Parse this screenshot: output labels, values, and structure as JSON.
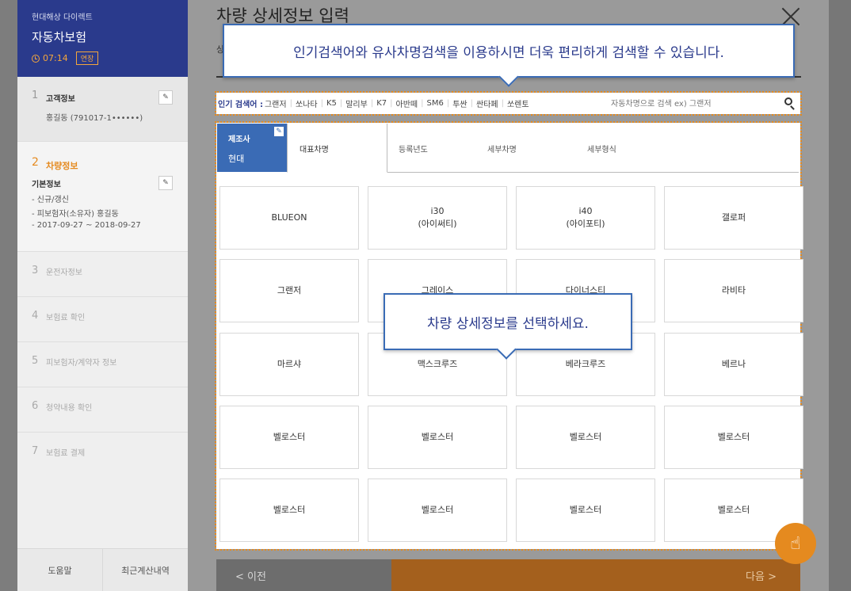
{
  "sidebar": {
    "brand": "현대해상 다이렉트",
    "product": "자동차보험",
    "timer": "07:14",
    "extend_label": "연장",
    "steps": [
      {
        "num": "1",
        "name": "고객정보",
        "detail": "홍길동 (791017-1••••••)"
      },
      {
        "num": "2",
        "name": "차량정보",
        "sub_title": "기본정보",
        "lines": [
          "- 신규/갱신",
          "- 피보험자(소유자) 홍길동",
          "- 2017-09-27 ~ 2018-09-27"
        ]
      },
      {
        "num": "3",
        "name": "운전자정보"
      },
      {
        "num": "4",
        "name": "보험료 확인"
      },
      {
        "num": "5",
        "name": "피보험자/계약자 정보"
      },
      {
        "num": "6",
        "name": "청약내용 확인"
      },
      {
        "num": "7",
        "name": "보험료 결제"
      }
    ],
    "footer": {
      "help": "도움말",
      "recent": "최근계산내역"
    }
  },
  "main": {
    "title": "차량 상세정보 입력",
    "subtitle": "상",
    "search": {
      "popular_label": "인기 검색어 :",
      "popular": [
        "그랜저",
        "쏘나타",
        "K5",
        "말리부",
        "K7",
        "아반떼",
        "SM6",
        "투싼",
        "싼타페",
        "쏘렌토"
      ],
      "placeholder": "자동차명으로 검색 ex) 그랜저"
    },
    "maker": {
      "label": "제조사",
      "value": "현대"
    },
    "tabs": [
      "대표차명",
      "등록년도",
      "세부차명",
      "세부형식"
    ],
    "cars": [
      {
        "line1": "BLUEON",
        "line2": ""
      },
      {
        "line1": "i30",
        "line2": "(아이써티)"
      },
      {
        "line1": "i40",
        "line2": "(아이포티)"
      },
      {
        "line1": "갤로퍼",
        "line2": ""
      },
      {
        "line1": "그랜저",
        "line2": ""
      },
      {
        "line1": "그레이스",
        "line2": ""
      },
      {
        "line1": "다이너스티",
        "line2": ""
      },
      {
        "line1": "라비타",
        "line2": ""
      },
      {
        "line1": "마르샤",
        "line2": ""
      },
      {
        "line1": "맥스크루즈",
        "line2": ""
      },
      {
        "line1": "베라크루즈",
        "line2": ""
      },
      {
        "line1": "베르나",
        "line2": ""
      },
      {
        "line1": "벨로스터",
        "line2": ""
      },
      {
        "line1": "벨로스터",
        "line2": ""
      },
      {
        "line1": "벨로스터",
        "line2": ""
      },
      {
        "line1": "벨로스터",
        "line2": ""
      },
      {
        "line1": "벨로스터",
        "line2": ""
      },
      {
        "line1": "벨로스터",
        "line2": ""
      },
      {
        "line1": "벨로스터",
        "line2": ""
      },
      {
        "line1": "벨로스터",
        "line2": ""
      }
    ],
    "prev_label": "< 이전",
    "next_label": "다음 >"
  },
  "tooltips": {
    "search": "인기검색어와 유사차명검색을 이용하시면 더욱 편리하게 검색할 수 있습니다.",
    "detail": "차량 상세정보를 선택하세요."
  },
  "icons": {
    "clock": "clock-icon",
    "edit": "pencil-icon",
    "close": "close-icon",
    "search": "search-icon",
    "touch": "hand-pointer-icon"
  },
  "colors": {
    "brand_navy": "#2a3a8c",
    "accent_orange": "#e58a1f",
    "maker_blue": "#3a6bb5"
  }
}
